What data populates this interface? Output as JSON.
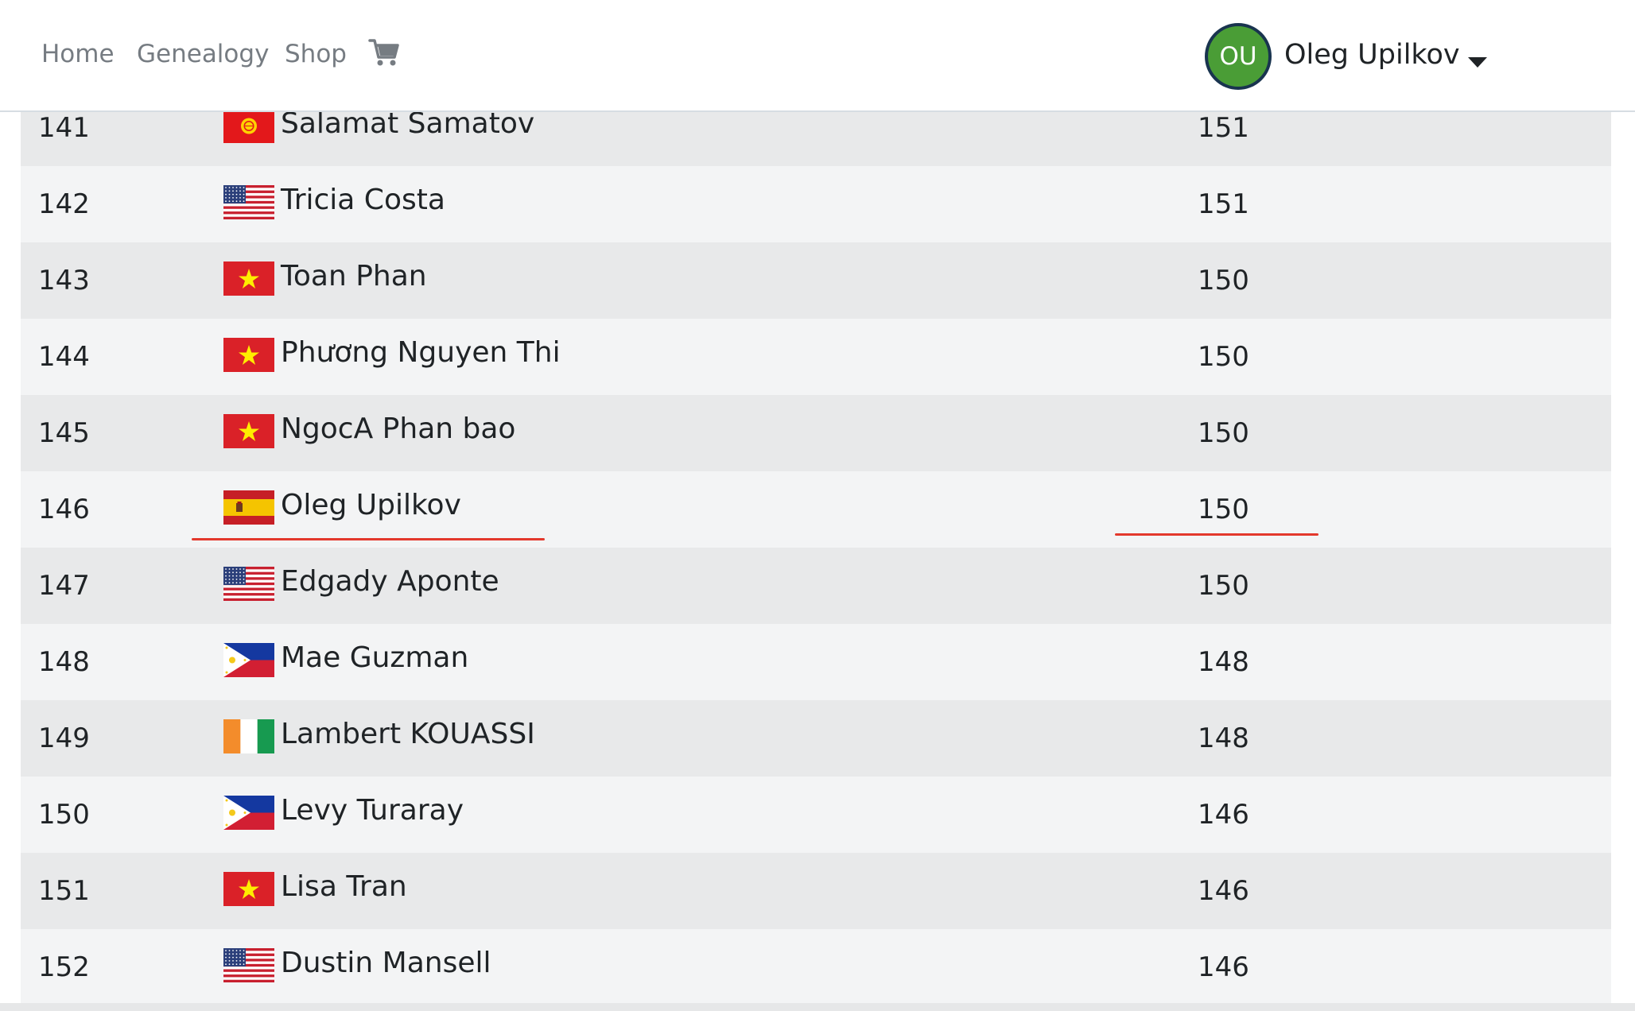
{
  "nav": {
    "home": "Home",
    "genealogy": "Genealogy",
    "shop": "Shop",
    "cart_icon": "shopping-cart-icon"
  },
  "user": {
    "initials": "OU",
    "name": "Oleg Upilkov",
    "avatar_color": "#4a9d36",
    "avatar_border": "#19344f"
  },
  "colors": {
    "row_odd": "#e8e9ea",
    "row_even": "#f3f4f5",
    "highlight_underline": "#e3382c"
  },
  "leaderboard": {
    "highlighted_rank": "146",
    "rows": [
      {
        "rank": "141",
        "name": "Salamat Samatov",
        "score": "151",
        "flag": "kyrgyzstan"
      },
      {
        "rank": "142",
        "name": "Tricia Costa",
        "score": "151",
        "flag": "usa"
      },
      {
        "rank": "143",
        "name": "Toan Phan",
        "score": "150",
        "flag": "vietnam"
      },
      {
        "rank": "144",
        "name": "Phương Nguyen Thi",
        "score": "150",
        "flag": "vietnam"
      },
      {
        "rank": "145",
        "name": "NgocA Phan bao",
        "score": "150",
        "flag": "vietnam"
      },
      {
        "rank": "146",
        "name": "Oleg Upilkov",
        "score": "150",
        "flag": "spain"
      },
      {
        "rank": "147",
        "name": "Edgady Aponte",
        "score": "150",
        "flag": "usa"
      },
      {
        "rank": "148",
        "name": " Mae Guzman",
        "score": "148",
        "flag": "philippines"
      },
      {
        "rank": "149",
        "name": "Lambert KOUASSI",
        "score": "148",
        "flag": "ivory-coast"
      },
      {
        "rank": "150",
        "name": "Levy Turaray",
        "score": "146",
        "flag": "philippines"
      },
      {
        "rank": "151",
        "name": "Lisa Tran",
        "score": "146",
        "flag": "vietnam"
      },
      {
        "rank": "152",
        "name": "Dustin Mansell",
        "score": "146",
        "flag": "usa"
      }
    ]
  }
}
